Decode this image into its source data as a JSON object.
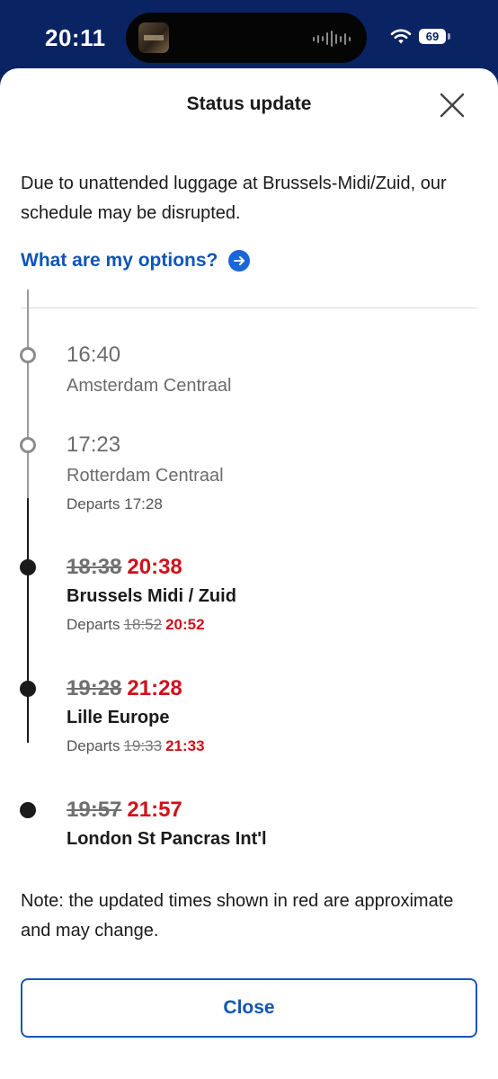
{
  "status_bar": {
    "time": "20:11",
    "battery": "69"
  },
  "sheet": {
    "title": "Status update",
    "message": "Due to unattended luggage at Brussels-Midi/Zuid, our schedule may be disrupted.",
    "options_link": "What are my options?",
    "note": "Note: the updated times shown in red are approximate and may change.",
    "close_button": "Close"
  },
  "stops": [
    {
      "time": "16:40",
      "station": "Amsterdam Centraal"
    },
    {
      "time": "17:23",
      "station": "Rotterdam Centraal",
      "departs_label": "Departs",
      "departs": "17:28"
    },
    {
      "old_time": "18:38",
      "new_time": "20:38",
      "station": "Brussels Midi / Zuid",
      "departs_label": "Departs",
      "departs_old": "18:52",
      "departs_new": "20:52"
    },
    {
      "old_time": "19:28",
      "new_time": "21:28",
      "station": "Lille Europe",
      "departs_label": "Departs",
      "departs_old": "19:33",
      "departs_new": "21:33"
    },
    {
      "old_time": "19:57",
      "new_time": "21:57",
      "station": "London St Pancras Int'l"
    }
  ],
  "colors": {
    "brand_navy": "#0a2463",
    "link_blue": "#1055b4",
    "delay_red": "#d0111b"
  },
  "icons": {
    "close": "close-icon",
    "options": "arrow-right-circle-icon",
    "wifi": "wifi-icon",
    "battery": "battery-icon"
  }
}
